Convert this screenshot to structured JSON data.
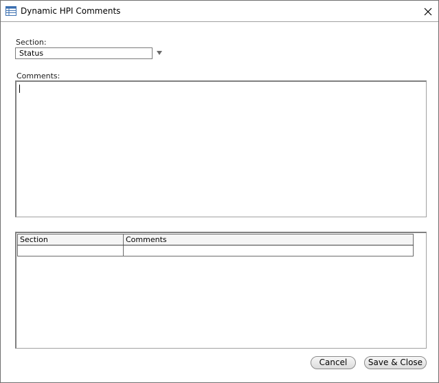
{
  "window": {
    "title": "Dynamic HPI Comments",
    "icon": "table-window-icon"
  },
  "form": {
    "section_label": "Section:",
    "section_value": "Status",
    "comments_label": "Comments:",
    "comments_value": ""
  },
  "grid": {
    "columns": [
      "Section",
      "Comments"
    ],
    "rows": [
      [
        "",
        ""
      ]
    ]
  },
  "buttons": {
    "cancel": "Cancel",
    "save_close": "Save & Close"
  },
  "colors": {
    "border": "#a0a0a0",
    "button_bg": "#e6e6e6",
    "icon_blue": "#3a6fb0"
  }
}
